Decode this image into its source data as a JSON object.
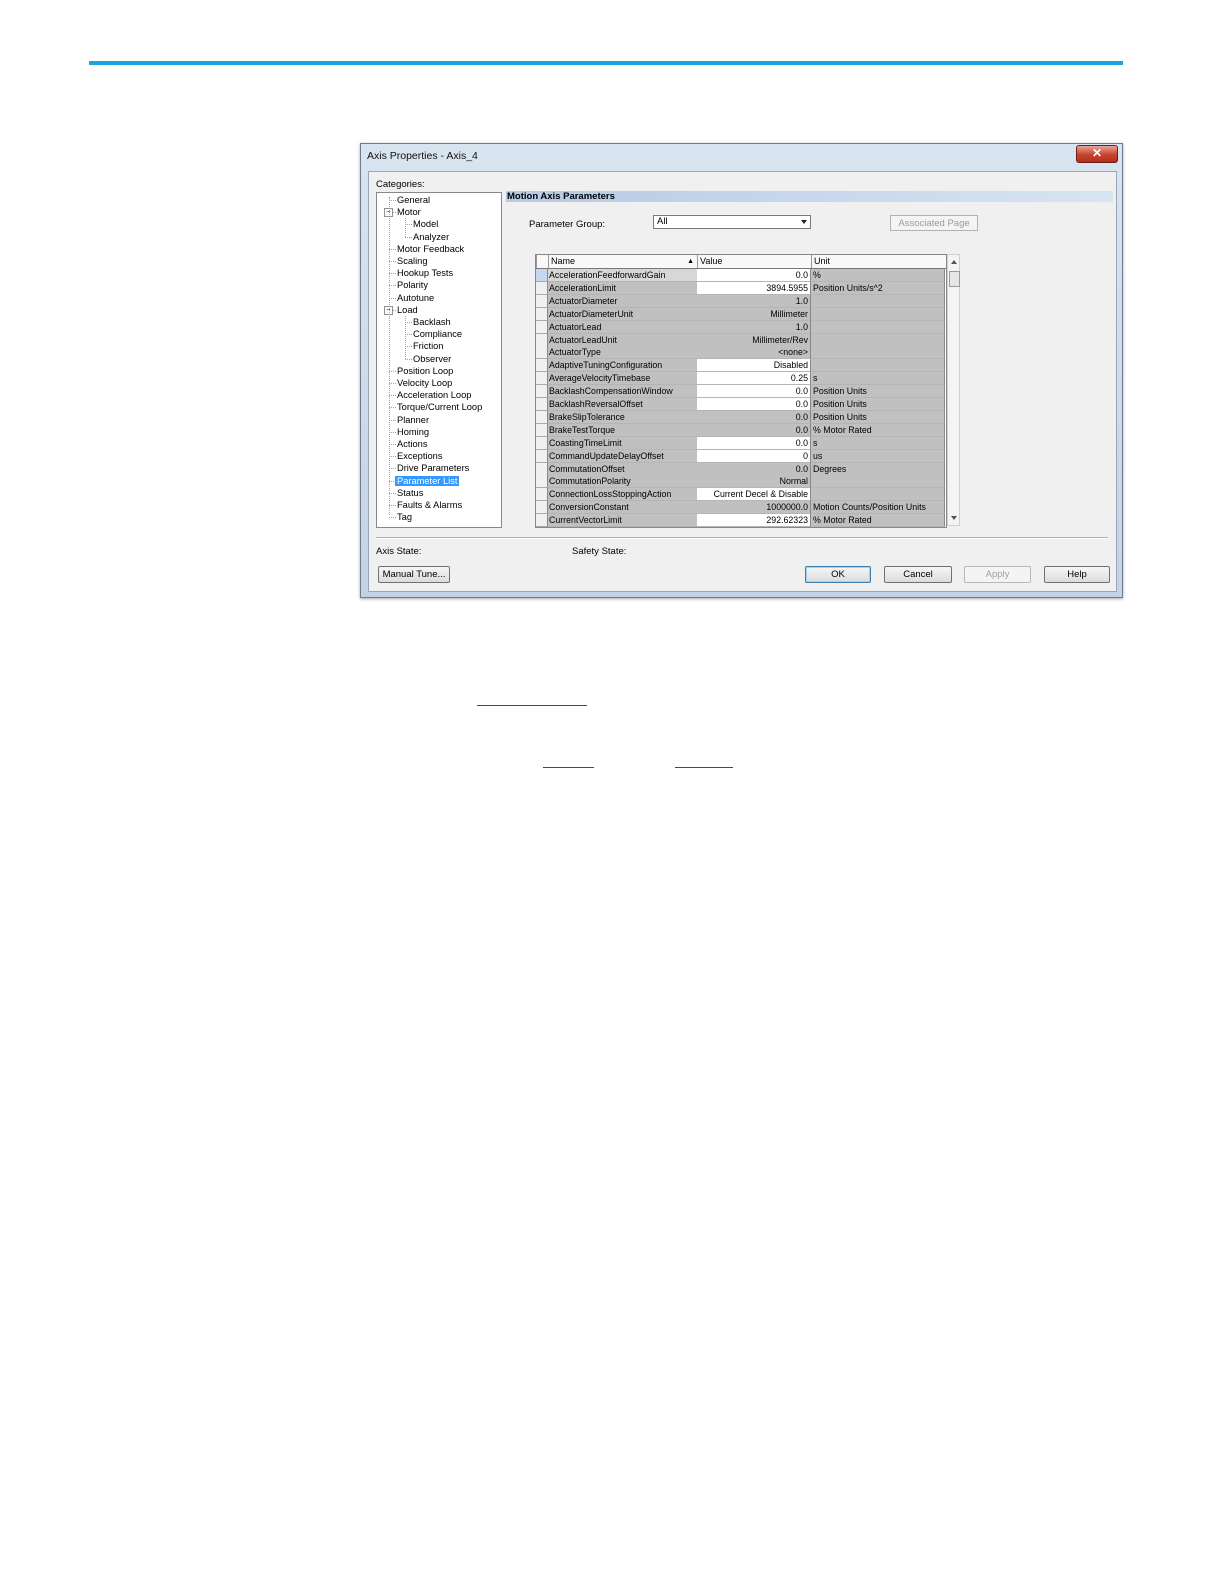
{
  "window": {
    "title": "Axis Properties - Axis_4",
    "close_label": "✕"
  },
  "categories": {
    "label": "Categories:",
    "items": [
      {
        "label": "General"
      },
      {
        "label": "Motor"
      },
      {
        "label": "Model"
      },
      {
        "label": "Analyzer"
      },
      {
        "label": "Motor Feedback"
      },
      {
        "label": "Scaling"
      },
      {
        "label": "Hookup Tests"
      },
      {
        "label": "Polarity"
      },
      {
        "label": "Autotune"
      },
      {
        "label": "Load"
      },
      {
        "label": "Backlash"
      },
      {
        "label": "Compliance"
      },
      {
        "label": "Friction"
      },
      {
        "label": "Observer"
      },
      {
        "label": "Position Loop"
      },
      {
        "label": "Velocity Loop"
      },
      {
        "label": "Acceleration Loop"
      },
      {
        "label": "Torque/Current Loop"
      },
      {
        "label": "Planner"
      },
      {
        "label": "Homing"
      },
      {
        "label": "Actions"
      },
      {
        "label": "Exceptions"
      },
      {
        "label": "Drive Parameters"
      },
      {
        "label": "Parameter List",
        "selected": true
      },
      {
        "label": "Status"
      },
      {
        "label": "Faults & Alarms"
      },
      {
        "label": "Tag"
      }
    ]
  },
  "panel": {
    "heading": "Motion Axis Parameters",
    "parameter_group_label": "Parameter Group:",
    "parameter_group_value": "All",
    "associated_page_label": "Associated Page"
  },
  "grid": {
    "columns": [
      "Name",
      "Value",
      "Unit"
    ],
    "rows": [
      {
        "name": "AccelerationFeedforwardGain",
        "value": "0.0",
        "unit": "%",
        "editable": true
      },
      {
        "name": "AccelerationLimit",
        "value": "3894.5955",
        "unit": "Position Units/s^2",
        "editable": true
      },
      {
        "name": "ActuatorDiameter",
        "value": "1.0",
        "unit": "",
        "editable": false
      },
      {
        "name": "ActuatorDiameterUnit",
        "value": "Millimeter",
        "unit": "",
        "editable": false
      },
      {
        "name": "ActuatorLead",
        "value": "1.0",
        "unit": "",
        "editable": false
      },
      {
        "name": "ActuatorLeadUnit",
        "value": "Millimeter/Rev",
        "unit": "",
        "editable": false
      },
      {
        "name": "ActuatorType",
        "value": "<none>",
        "unit": "",
        "editable": false
      },
      {
        "name": "AdaptiveTuningConfiguration",
        "value": "Disabled",
        "unit": "",
        "editable": true
      },
      {
        "name": "AverageVelocityTimebase",
        "value": "0.25",
        "unit": "s",
        "editable": true
      },
      {
        "name": "BacklashCompensationWindow",
        "value": "0.0",
        "unit": "Position Units",
        "editable": true
      },
      {
        "name": "BacklashReversalOffset",
        "value": "0.0",
        "unit": "Position Units",
        "editable": true
      },
      {
        "name": "BrakeSlipTolerance",
        "value": "0.0",
        "unit": "Position Units",
        "editable": false
      },
      {
        "name": "BrakeTestTorque",
        "value": "0.0",
        "unit": "% Motor Rated",
        "editable": false
      },
      {
        "name": "CoastingTimeLimit",
        "value": "0.0",
        "unit": "s",
        "editable": true
      },
      {
        "name": "CommandUpdateDelayOffset",
        "value": "0",
        "unit": "us",
        "editable": true
      },
      {
        "name": "CommutationOffset",
        "value": "0.0",
        "unit": "Degrees",
        "editable": false
      },
      {
        "name": "CommutationPolarity",
        "value": "Normal",
        "unit": "",
        "editable": false
      },
      {
        "name": "ConnectionLossStoppingAction",
        "value": "Current Decel & Disable",
        "unit": "",
        "editable": true
      },
      {
        "name": "ConversionConstant",
        "value": "1000000.0",
        "unit": "Motion Counts/Position Units",
        "editable": false
      },
      {
        "name": "CurrentVectorLimit",
        "value": "292.62323",
        "unit": "% Motor Rated",
        "editable": true
      }
    ]
  },
  "footer": {
    "axis_state_label": "Axis State:",
    "safety_state_label": "Safety State:",
    "manual_tune_label": "Manual Tune...",
    "ok_label": "OK",
    "cancel_label": "Cancel",
    "apply_label": "Apply",
    "help_label": "Help"
  },
  "colors": {
    "accent_rule": "#1ea3dc",
    "selection": "#3399ff"
  }
}
